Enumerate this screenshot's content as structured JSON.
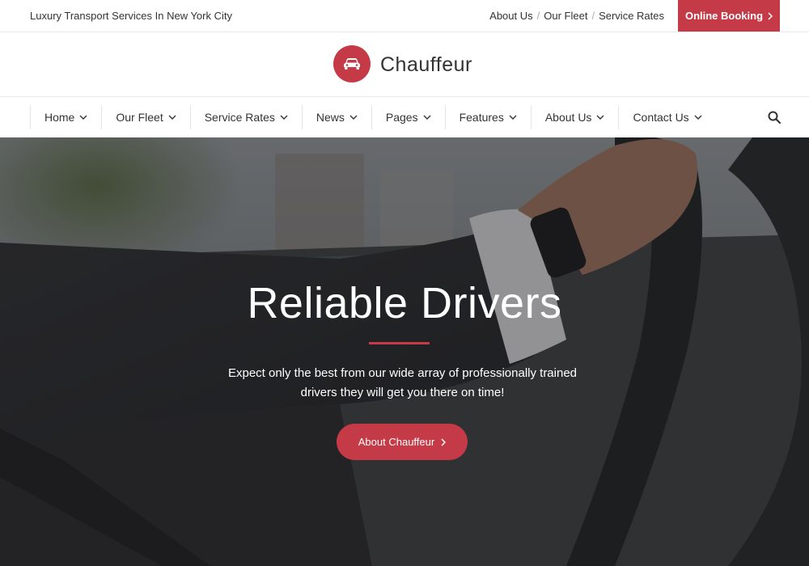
{
  "topbar": {
    "tagline": "Luxury Transport Services In New York City",
    "links": [
      "About Us",
      "Our Fleet",
      "Service Rates"
    ],
    "separator": "/",
    "booking_label": "Online Booking"
  },
  "logo": {
    "name": "Chauffeur",
    "icon": "car-icon"
  },
  "nav": {
    "items": [
      "Home",
      "Our Fleet",
      "Service Rates",
      "News",
      "Pages",
      "Features",
      "About Us",
      "Contact Us"
    ],
    "search_icon": "search-icon"
  },
  "hero": {
    "title": "Reliable Drivers",
    "text": "Expect only the best from our wide array of professionally trained drivers they will get you there on time!",
    "button_label": "About Chauffeur"
  },
  "colors": {
    "accent": "#c53a47",
    "text": "#333333",
    "hero_overlay": "#2b2c2e"
  }
}
